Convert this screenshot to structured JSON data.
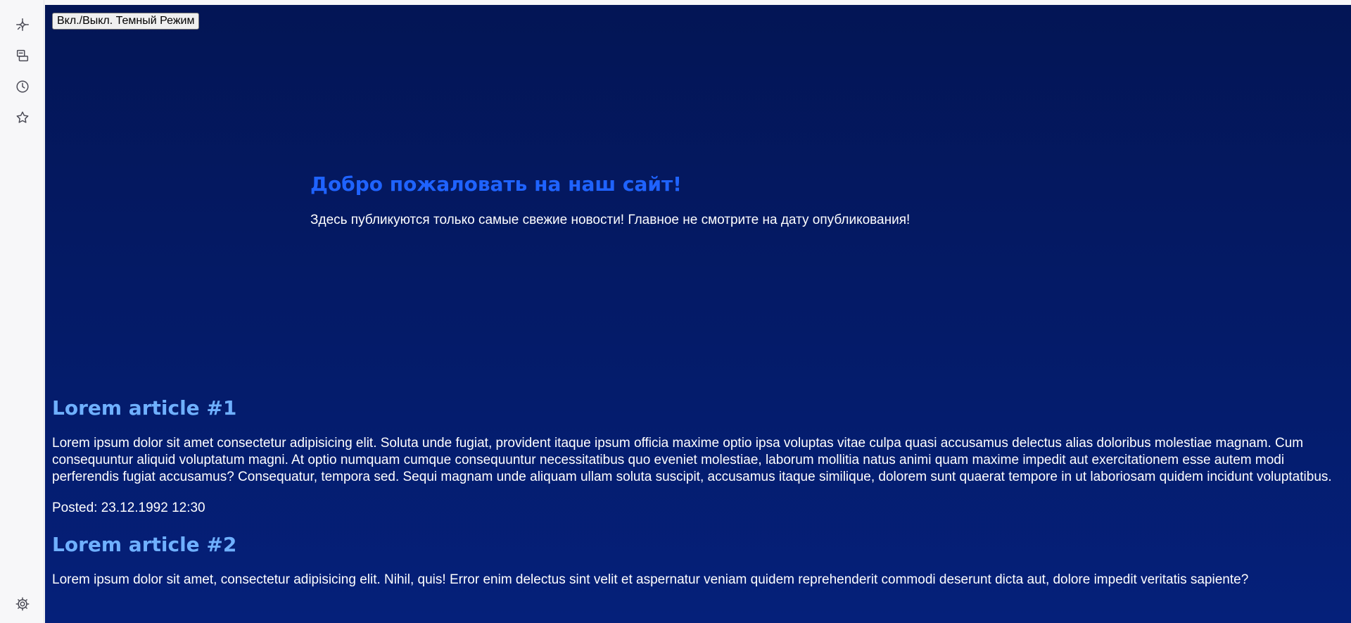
{
  "sidebar": {
    "items": [
      {
        "icon": "sparkle-icon"
      },
      {
        "icon": "collections-icon"
      },
      {
        "icon": "history-icon"
      },
      {
        "icon": "favorites-star-icon"
      }
    ],
    "settings_icon": "gear-icon"
  },
  "page": {
    "toggle_label": "Вкл./Выкл. Темный Режим",
    "hero": {
      "title": "Добро пожаловать на наш сайт!",
      "subtitle": "Здесь публикуются только самые свежие новости! Главное не смотрите на дату опубликования!"
    },
    "articles": [
      {
        "title": "Lorem article #1",
        "body": "Lorem ipsum dolor sit amet consectetur adipisicing elit. Soluta unde fugiat, provident itaque ipsum officia maxime optio ipsa voluptas vitae culpa quasi accusamus delectus alias doloribus molestiae magnam. Cum consequuntur aliquid voluptatum magni. At optio numquam cumque consequuntur necessitatibus quo eveniet molestiae, laborum mollitia natus animi quam maxime impedit aut exercitationem esse autem modi perferendis fugiat accusamus? Consequatur, tempora sed. Sequi magnam unde aliquam ullam soluta suscipit, accusamus itaque similique, dolorem sunt quaerat tempore in ut laboriosam quidem incidunt voluptatibus.",
        "posted": "Posted: 23.12.1992 12:30"
      },
      {
        "title": "Lorem article #2",
        "body": "Lorem ipsum dolor sit amet, consectetur adipisicing elit. Nihil, quis! Error enim delectus sint velit et aspernatur veniam quidem reprehenderit commodi deserunt dicta aut, dolore impedit veritatis sapiente?",
        "posted": ""
      }
    ]
  },
  "colors": {
    "page_bg_top": "#031555",
    "page_bg_bottom": "#05207a",
    "hero_title": "#1f63ff",
    "article_title": "#6fb0ff",
    "text": "#ffffff"
  }
}
